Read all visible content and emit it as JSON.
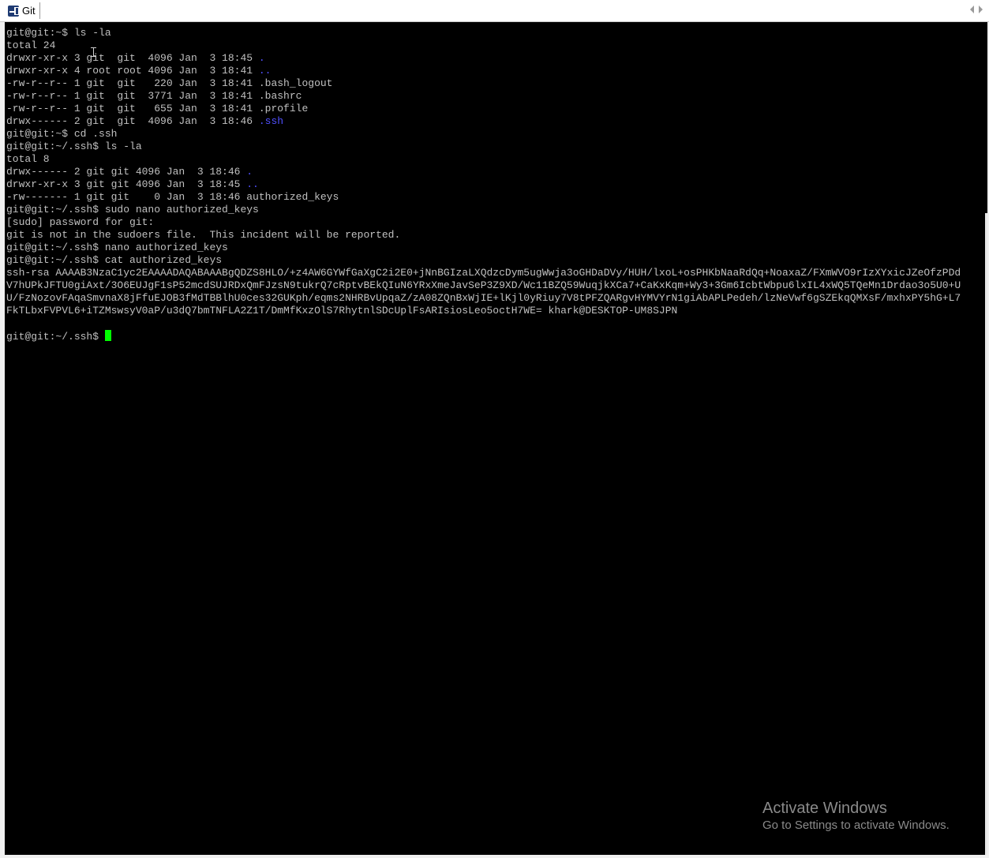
{
  "window": {
    "tab_title": "Git",
    "tab_icon": "putty-terminal-icon",
    "scroll_left_icon": "chevron-left-icon",
    "scroll_right_icon": "chevron-right-icon"
  },
  "colors": {
    "background": "#000000",
    "text": "#c0c0c0",
    "directory": "#5050ff",
    "cursor": "#00ff00"
  },
  "terminal": {
    "lines": [
      {
        "text": "git@git:~$ ls -la"
      },
      {
        "text": "total 24"
      },
      {
        "text": "drwxr-xr-x 3 git  git  4096 Jan  3 18:45 ",
        "dir": "."
      },
      {
        "text": "drwxr-xr-x 4 root root 4096 Jan  3 18:41 ",
        "dir": ".."
      },
      {
        "text": "-rw-r--r-- 1 git  git   220 Jan  3 18:41 .bash_logout"
      },
      {
        "text": "-rw-r--r-- 1 git  git  3771 Jan  3 18:41 .bashrc"
      },
      {
        "text": "-rw-r--r-- 1 git  git   655 Jan  3 18:41 .profile"
      },
      {
        "text": "drwx------ 2 git  git  4096 Jan  3 18:46 ",
        "dir": ".ssh"
      },
      {
        "text": "git@git:~$ cd .ssh"
      },
      {
        "text": "git@git:~/.ssh$ ls -la"
      },
      {
        "text": "total 8"
      },
      {
        "text": "drwx------ 2 git git 4096 Jan  3 18:46 ",
        "dir": "."
      },
      {
        "text": "drwxr-xr-x 3 git git 4096 Jan  3 18:45 ",
        "dir": ".."
      },
      {
        "text": "-rw------- 1 git git    0 Jan  3 18:46 authorized_keys"
      },
      {
        "text": "git@git:~/.ssh$ sudo nano authorized_keys"
      },
      {
        "text": "[sudo] password for git:"
      },
      {
        "text": "git is not in the sudoers file.  This incident will be reported."
      },
      {
        "text": "git@git:~/.ssh$ nano authorized_keys"
      },
      {
        "text": "git@git:~/.ssh$ cat authorized_keys"
      },
      {
        "text": "ssh-rsa AAAAB3NzaC1yc2EAAAADAQABAAABgQDZS8HLO/+z4AW6GYWfGaXgC2i2E0+jNnBGIzaLXQdzcDym5ugWwja3oGHDaDVy/HUH/lxoL+osPHKbNaaRdQq+NoaxaZ/FXmWVO9rIzXYxicJZeOfzPDd"
      },
      {
        "text": "V7hUPkJFTU0giAxt/3O6EUJgF1sP52mcdSUJRDxQmFJzsN9tukrQ7cRptvBEkQIuN6YRxXmeJavSeP3Z9XD/Wc11BZQ59WuqjkXCa7+CaKxKqm+Wy3+3Gm6IcbtWbpu6lxIL4xWQ5TQeMn1Drdao3o5U0+U"
      },
      {
        "text": "U/FzNozovFAqaSmvnaX8jFfuEJOB3fMdTBBlhU0ces32GUKph/eqms2NHRBvUpqaZ/zA08ZQnBxWjIE+lKjl0yRiuy7V8tPFZQARgvHYMVYrN1giAbAPLPedeh/lzNeVwf6gSZEkqQMXsF/mxhxPY5hG+L7"
      },
      {
        "text": "FkTLbxFVPVL6+iTZMswsyV0aP/u3dQ7bmTNFLA2Z1T/DmMfKxzOlS7RhytnlSDcUplFsARIsiosLeo5octH7WE= khark@DESKTOP-UM8SJPN"
      },
      {
        "text": ""
      },
      {
        "text": "git@git:~/.ssh$ ",
        "cursor": true
      }
    ]
  },
  "watermark": {
    "title": "Activate Windows",
    "subtitle": "Go to Settings to activate Windows."
  }
}
